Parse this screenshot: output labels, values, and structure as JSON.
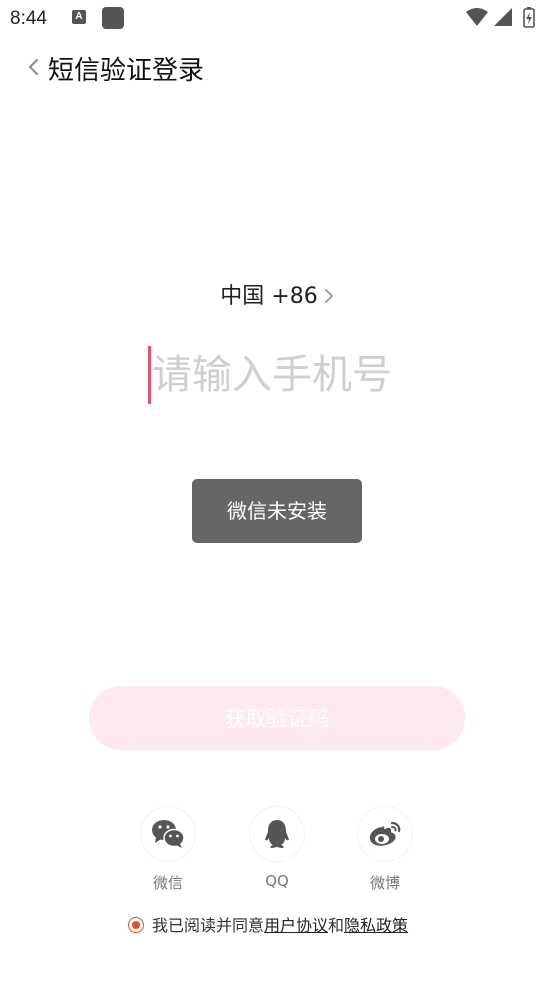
{
  "status_bar": {
    "time": "8:44",
    "notification_icon_text": "A",
    "icons": [
      "a-notification-icon",
      "app-square-icon",
      "wifi-icon",
      "signal-icon",
      "battery-icon"
    ]
  },
  "header": {
    "title": "短信验证登录",
    "back_icon": "chevron-left-icon"
  },
  "country": {
    "label": "中国 +86",
    "chevron_icon": "chevron-right-icon"
  },
  "phone_input": {
    "value": "",
    "placeholder": "请输入手机号",
    "caret_color": "#e0536b"
  },
  "toast": {
    "message": "微信未安装"
  },
  "get_code_button": {
    "label": "获取验证码",
    "background": "#fde9ee"
  },
  "social": [
    {
      "label": "微信",
      "icon": "wechat-icon"
    },
    {
      "label": "QQ",
      "icon": "qq-icon"
    },
    {
      "label": "微博",
      "icon": "weibo-icon"
    }
  ],
  "agreement": {
    "prefix": "我已阅读并同意",
    "user_agreement": "用户协议",
    "connector": "和",
    "privacy_policy": "隐私政策",
    "accent": "#e8502a"
  }
}
